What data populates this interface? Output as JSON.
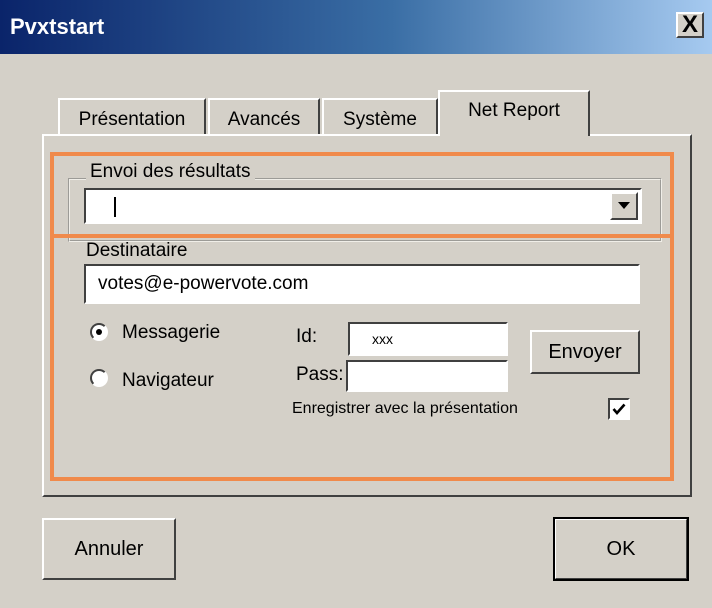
{
  "window": {
    "title": "Pvxtstart",
    "close_symbol": "X"
  },
  "tabs": [
    {
      "label": "Présentation",
      "active": false
    },
    {
      "label": "Avancés",
      "active": false
    },
    {
      "label": "Système",
      "active": false
    },
    {
      "label": "Net Report",
      "active": true
    }
  ],
  "send_results": {
    "legend": "Envoi des résultats",
    "selected_value": ""
  },
  "recipient": {
    "label": "Destinataire",
    "value": "votes@e-powervote.com"
  },
  "method": {
    "options": [
      {
        "label": "Messagerie",
        "selected": true
      },
      {
        "label": "Navigateur",
        "selected": false
      }
    ]
  },
  "credentials": {
    "id_label": "Id:",
    "id_value": "xxx",
    "pass_label": "Pass:",
    "pass_value": ""
  },
  "send_button": "Envoyer",
  "save_with_presentation": {
    "label": "Enregistrer avec la présentation",
    "checked": true
  },
  "footer": {
    "cancel_label": "Annuler",
    "ok_label": "OK"
  },
  "colors": {
    "highlight": "#f08a4b",
    "title_start": "#0a246a",
    "title_end": "#a6caf0"
  }
}
